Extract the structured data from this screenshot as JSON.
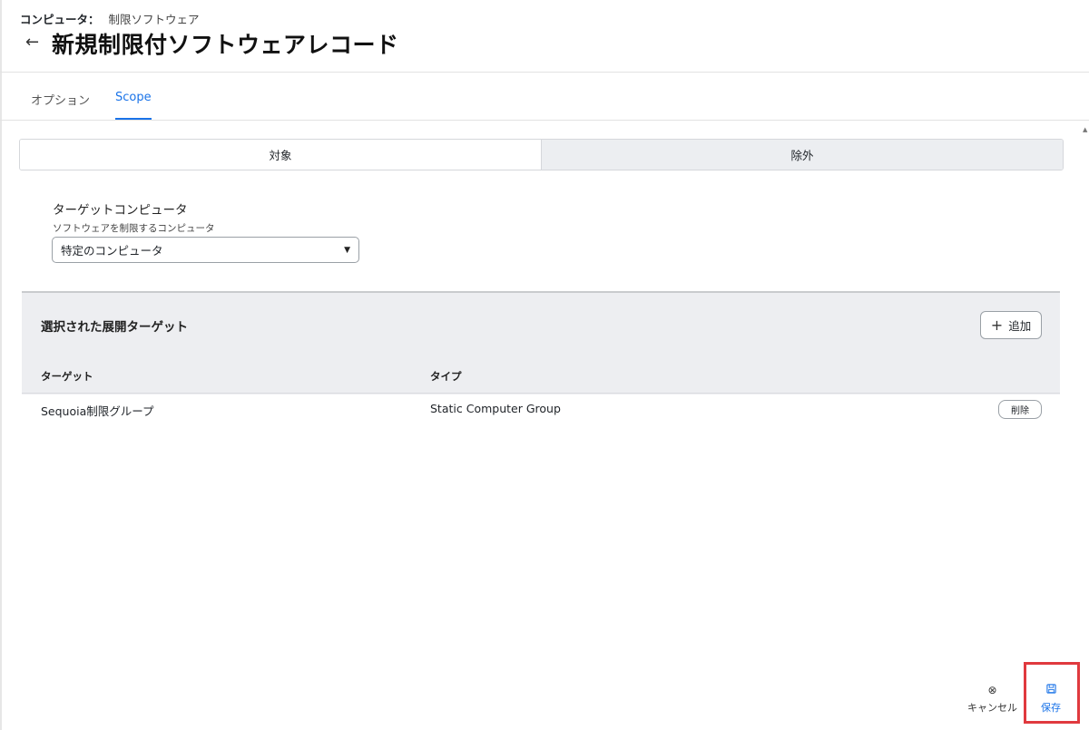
{
  "breadcrumb": {
    "parent": "コンピュータ：",
    "current": "制限ソフトウェア"
  },
  "page": {
    "back_icon": "←",
    "title": "新規制限付ソフトウェアレコード"
  },
  "tabs": [
    {
      "label": "オプション",
      "active": false
    },
    {
      "label": "Scope",
      "active": true
    }
  ],
  "scope_toggle": {
    "options": [
      "対象",
      "除外"
    ],
    "selected": "対象"
  },
  "target_computers": {
    "label": "ターゲットコンピュータ",
    "help": "ソフトウェアを制限するコンピュータ",
    "selected": "特定のコンピュータ"
  },
  "targets_table": {
    "title": "選択された展開ターゲット",
    "add_label": "追加",
    "columns": [
      "ターゲット",
      "タイプ"
    ],
    "rows": [
      {
        "target": "Sequoia制限グループ",
        "type": "Static Computer Group",
        "action": "削除"
      }
    ]
  },
  "footer": {
    "cancel_label": "キャンセル",
    "save_label": "保存"
  },
  "colors": {
    "accent": "#1a73e8",
    "highlight": "#e0393e",
    "panel_bg": "#edeef1"
  },
  "icons": {
    "back": "arrow-left-icon",
    "add": "plus-icon",
    "cancel": "close-circle-icon",
    "save": "floppy-disk-icon",
    "select": "caret-down-icon"
  }
}
